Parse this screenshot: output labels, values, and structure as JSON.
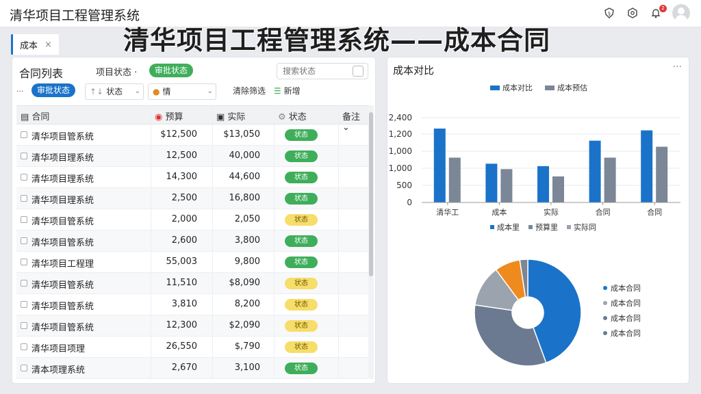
{
  "header": {
    "app_title": "清华项目工程管理系统",
    "notification_count": "2"
  },
  "headline": "清华项目工程管理系统——成本合同",
  "tab": {
    "label": "成本",
    "close": "×"
  },
  "left": {
    "title": "合同列表",
    "filter_label": "项目状态 ·",
    "filter_pill": "审批状态",
    "search_placeholder": "搜索状态",
    "filter2_dots": "···",
    "filter2_pill": "审批状态",
    "select1": "状态",
    "select2": "情",
    "btn1": "清除筛选",
    "btn2": "新增",
    "columns": [
      "合同",
      "预算",
      "实际",
      "状态",
      "备注"
    ],
    "rows": [
      {
        "name": "清华项目管系统",
        "a": "$12,500",
        "b": "$13,050",
        "status": "状态",
        "color": "green"
      },
      {
        "name": "清华项目理系统",
        "a": "12,500",
        "b": "40,000",
        "status": "状态",
        "color": "green"
      },
      {
        "name": "清华项目理系统",
        "a": "14,300",
        "b": "44,600",
        "status": "状态",
        "color": "green"
      },
      {
        "name": "清华项目理系统",
        "a": "2,500",
        "b": "16,800",
        "status": "状态",
        "color": "green"
      },
      {
        "name": "清华项目管系统",
        "a": "2,000",
        "b": "2,050",
        "status": "状态",
        "color": "yellow"
      },
      {
        "name": "清华项目管系统",
        "a": "2,600",
        "b": "3,800",
        "status": "状态",
        "color": "green"
      },
      {
        "name": "清华项目工程理",
        "a": "55,003",
        "b": "9,800",
        "status": "状态",
        "color": "green"
      },
      {
        "name": "清华项目管系统",
        "a": "11,510",
        "b": "$8,090",
        "status": "状态",
        "color": "yellow"
      },
      {
        "name": "清华项目管系统",
        "a": "3,810",
        "b": "8,200",
        "status": "状态",
        "color": "yellow"
      },
      {
        "name": "清华项目管系统",
        "a": "12,300",
        "b": "$2,090",
        "status": "状态",
        "color": "yellow"
      },
      {
        "name": "清华项目项理",
        "a": "26,550",
        "b": "$,790",
        "status": "状态",
        "color": "yellow"
      },
      {
        "name": "清本项理系统",
        "a": "2,670",
        "b": "3,100",
        "status": "状态",
        "color": "green"
      }
    ]
  },
  "right": {
    "title": "成本对比",
    "more": "···",
    "pie_legend": [
      "成本合同",
      "成本合同",
      "成本合同",
      "成本合同"
    ]
  },
  "colors": {
    "blue": "#1a73c9",
    "gray": "#7b8696",
    "orange": "#ef8a1f",
    "light_gray": "#9aa3ae",
    "slate": "#6b7a90"
  },
  "chart_data": [
    {
      "type": "bar",
      "title": "",
      "legend": [
        "成本对比",
        "成本预估"
      ],
      "bottom_legend": [
        "成本里",
        "预算里",
        "实际同"
      ],
      "categories": [
        "清华工",
        "成本",
        "实际",
        "合同",
        "合同"
      ],
      "ylim": [
        0,
        1400
      ],
      "yticks": [
        "0",
        "500",
        "1,000",
        "1,000",
        "1,200",
        "2,400"
      ],
      "series": [
        {
          "name": "成本对比",
          "values": [
            1220,
            640,
            600,
            1020,
            1190
          ]
        },
        {
          "name": "成本预估",
          "values": [
            740,
            550,
            430,
            740,
            920
          ]
        }
      ]
    },
    {
      "type": "pie",
      "legend": [
        "成本合同",
        "成本合同",
        "成本合同",
        "成本合同"
      ],
      "values": [
        46,
        34,
        13,
        8,
        2.5
      ],
      "colors": [
        "#1a73c9",
        "#6b7a90",
        "#9aa3ae",
        "#ef8a1f",
        "#7b8696"
      ]
    }
  ]
}
